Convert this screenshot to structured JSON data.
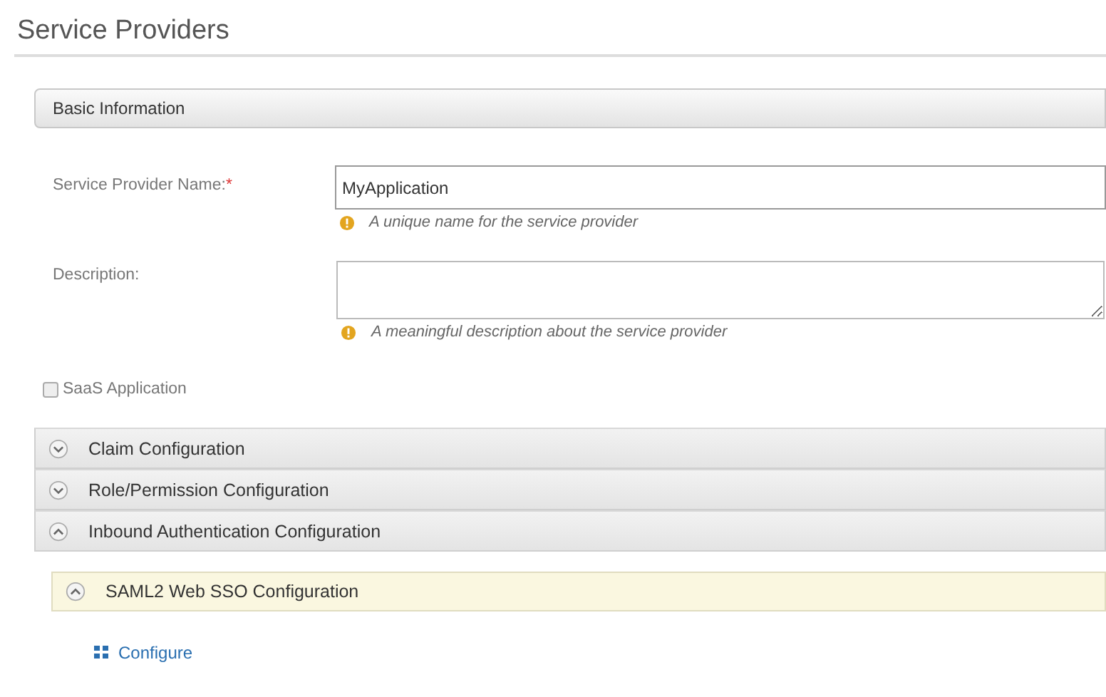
{
  "page_title": "Service Providers",
  "basic_information": {
    "heading": "Basic Information",
    "fields": [
      {
        "kind": "input",
        "label": "Service Provider Name:",
        "required_mark": "*",
        "value": "MyApplication",
        "hint": "A unique name for the service provider"
      },
      {
        "kind": "textarea",
        "label": "Description:",
        "hint": "A meaningful description about the service provider"
      }
    ],
    "saas_application": {
      "label": "SaaS Application",
      "checked": false
    }
  },
  "sections": [
    {
      "title": "Claim Configuration",
      "expanded": false
    },
    {
      "title": "Role/Permission Configuration",
      "expanded": false
    },
    {
      "title": "Inbound Authentication Configuration",
      "expanded": true,
      "subsections": [
        {
          "title": "SAML2 Web SSO Configuration",
          "expanded": true,
          "links": [
            "Configure"
          ]
        }
      ]
    }
  ]
}
